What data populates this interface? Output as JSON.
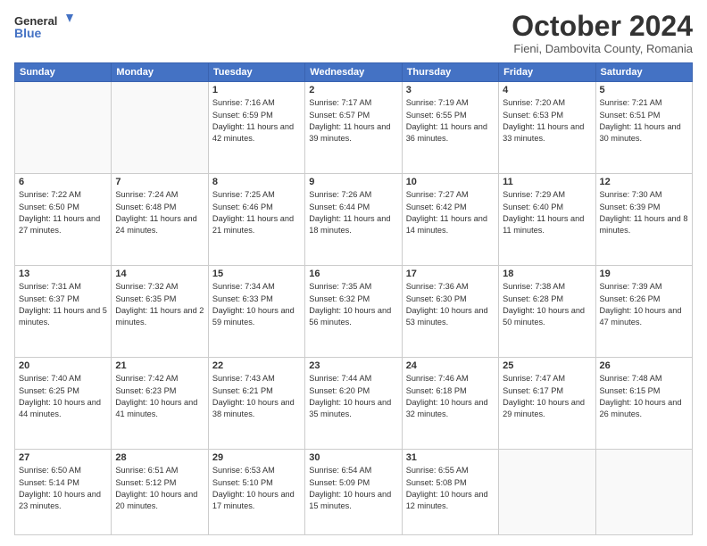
{
  "header": {
    "logo": {
      "general": "General",
      "blue": "Blue"
    },
    "month": "October 2024",
    "location": "Fieni, Dambovita County, Romania"
  },
  "weekdays": [
    "Sunday",
    "Monday",
    "Tuesday",
    "Wednesday",
    "Thursday",
    "Friday",
    "Saturday"
  ],
  "weeks": [
    [
      {
        "day": "",
        "empty": true
      },
      {
        "day": "",
        "empty": true
      },
      {
        "day": "1",
        "sunrise": "Sunrise: 7:16 AM",
        "sunset": "Sunset: 6:59 PM",
        "daylight": "Daylight: 11 hours and 42 minutes."
      },
      {
        "day": "2",
        "sunrise": "Sunrise: 7:17 AM",
        "sunset": "Sunset: 6:57 PM",
        "daylight": "Daylight: 11 hours and 39 minutes."
      },
      {
        "day": "3",
        "sunrise": "Sunrise: 7:19 AM",
        "sunset": "Sunset: 6:55 PM",
        "daylight": "Daylight: 11 hours and 36 minutes."
      },
      {
        "day": "4",
        "sunrise": "Sunrise: 7:20 AM",
        "sunset": "Sunset: 6:53 PM",
        "daylight": "Daylight: 11 hours and 33 minutes."
      },
      {
        "day": "5",
        "sunrise": "Sunrise: 7:21 AM",
        "sunset": "Sunset: 6:51 PM",
        "daylight": "Daylight: 11 hours and 30 minutes."
      }
    ],
    [
      {
        "day": "6",
        "sunrise": "Sunrise: 7:22 AM",
        "sunset": "Sunset: 6:50 PM",
        "daylight": "Daylight: 11 hours and 27 minutes."
      },
      {
        "day": "7",
        "sunrise": "Sunrise: 7:24 AM",
        "sunset": "Sunset: 6:48 PM",
        "daylight": "Daylight: 11 hours and 24 minutes."
      },
      {
        "day": "8",
        "sunrise": "Sunrise: 7:25 AM",
        "sunset": "Sunset: 6:46 PM",
        "daylight": "Daylight: 11 hours and 21 minutes."
      },
      {
        "day": "9",
        "sunrise": "Sunrise: 7:26 AM",
        "sunset": "Sunset: 6:44 PM",
        "daylight": "Daylight: 11 hours and 18 minutes."
      },
      {
        "day": "10",
        "sunrise": "Sunrise: 7:27 AM",
        "sunset": "Sunset: 6:42 PM",
        "daylight": "Daylight: 11 hours and 14 minutes."
      },
      {
        "day": "11",
        "sunrise": "Sunrise: 7:29 AM",
        "sunset": "Sunset: 6:40 PM",
        "daylight": "Daylight: 11 hours and 11 minutes."
      },
      {
        "day": "12",
        "sunrise": "Sunrise: 7:30 AM",
        "sunset": "Sunset: 6:39 PM",
        "daylight": "Daylight: 11 hours and 8 minutes."
      }
    ],
    [
      {
        "day": "13",
        "sunrise": "Sunrise: 7:31 AM",
        "sunset": "Sunset: 6:37 PM",
        "daylight": "Daylight: 11 hours and 5 minutes."
      },
      {
        "day": "14",
        "sunrise": "Sunrise: 7:32 AM",
        "sunset": "Sunset: 6:35 PM",
        "daylight": "Daylight: 11 hours and 2 minutes."
      },
      {
        "day": "15",
        "sunrise": "Sunrise: 7:34 AM",
        "sunset": "Sunset: 6:33 PM",
        "daylight": "Daylight: 10 hours and 59 minutes."
      },
      {
        "day": "16",
        "sunrise": "Sunrise: 7:35 AM",
        "sunset": "Sunset: 6:32 PM",
        "daylight": "Daylight: 10 hours and 56 minutes."
      },
      {
        "day": "17",
        "sunrise": "Sunrise: 7:36 AM",
        "sunset": "Sunset: 6:30 PM",
        "daylight": "Daylight: 10 hours and 53 minutes."
      },
      {
        "day": "18",
        "sunrise": "Sunrise: 7:38 AM",
        "sunset": "Sunset: 6:28 PM",
        "daylight": "Daylight: 10 hours and 50 minutes."
      },
      {
        "day": "19",
        "sunrise": "Sunrise: 7:39 AM",
        "sunset": "Sunset: 6:26 PM",
        "daylight": "Daylight: 10 hours and 47 minutes."
      }
    ],
    [
      {
        "day": "20",
        "sunrise": "Sunrise: 7:40 AM",
        "sunset": "Sunset: 6:25 PM",
        "daylight": "Daylight: 10 hours and 44 minutes."
      },
      {
        "day": "21",
        "sunrise": "Sunrise: 7:42 AM",
        "sunset": "Sunset: 6:23 PM",
        "daylight": "Daylight: 10 hours and 41 minutes."
      },
      {
        "day": "22",
        "sunrise": "Sunrise: 7:43 AM",
        "sunset": "Sunset: 6:21 PM",
        "daylight": "Daylight: 10 hours and 38 minutes."
      },
      {
        "day": "23",
        "sunrise": "Sunrise: 7:44 AM",
        "sunset": "Sunset: 6:20 PM",
        "daylight": "Daylight: 10 hours and 35 minutes."
      },
      {
        "day": "24",
        "sunrise": "Sunrise: 7:46 AM",
        "sunset": "Sunset: 6:18 PM",
        "daylight": "Daylight: 10 hours and 32 minutes."
      },
      {
        "day": "25",
        "sunrise": "Sunrise: 7:47 AM",
        "sunset": "Sunset: 6:17 PM",
        "daylight": "Daylight: 10 hours and 29 minutes."
      },
      {
        "day": "26",
        "sunrise": "Sunrise: 7:48 AM",
        "sunset": "Sunset: 6:15 PM",
        "daylight": "Daylight: 10 hours and 26 minutes."
      }
    ],
    [
      {
        "day": "27",
        "sunrise": "Sunrise: 6:50 AM",
        "sunset": "Sunset: 5:14 PM",
        "daylight": "Daylight: 10 hours and 23 minutes."
      },
      {
        "day": "28",
        "sunrise": "Sunrise: 6:51 AM",
        "sunset": "Sunset: 5:12 PM",
        "daylight": "Daylight: 10 hours and 20 minutes."
      },
      {
        "day": "29",
        "sunrise": "Sunrise: 6:53 AM",
        "sunset": "Sunset: 5:10 PM",
        "daylight": "Daylight: 10 hours and 17 minutes."
      },
      {
        "day": "30",
        "sunrise": "Sunrise: 6:54 AM",
        "sunset": "Sunset: 5:09 PM",
        "daylight": "Daylight: 10 hours and 15 minutes."
      },
      {
        "day": "31",
        "sunrise": "Sunrise: 6:55 AM",
        "sunset": "Sunset: 5:08 PM",
        "daylight": "Daylight: 10 hours and 12 minutes."
      },
      {
        "day": "",
        "empty": true
      },
      {
        "day": "",
        "empty": true
      }
    ]
  ]
}
